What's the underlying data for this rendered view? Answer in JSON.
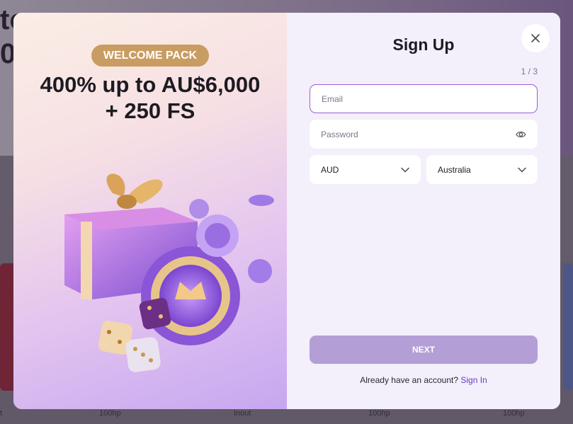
{
  "background": {
    "headline_line1": "to",
    "headline_line2": "0",
    "captions": [
      "t",
      "100hp",
      "Inout",
      "100hp",
      "100hp"
    ]
  },
  "promo": {
    "badge": "WELCOME PACK",
    "headline_line1": "400% up to AU$6,000",
    "headline_line2": "+ 250 FS",
    "colors": {
      "badge": "#c99c62",
      "gift": "#a86be0",
      "chip": "#8a55d6"
    }
  },
  "signup": {
    "title": "Sign Up",
    "step": "1 / 3",
    "email_placeholder": "Email",
    "password_placeholder": "Password",
    "currency": "AUD",
    "country": "Australia",
    "next_label": "NEXT",
    "have_account_text": "Already have an account?",
    "signin_link": "Sign In"
  },
  "icons": {
    "close": "close-icon",
    "password_toggle": "eye-icon",
    "dropdown": "chevron-down-icon"
  }
}
